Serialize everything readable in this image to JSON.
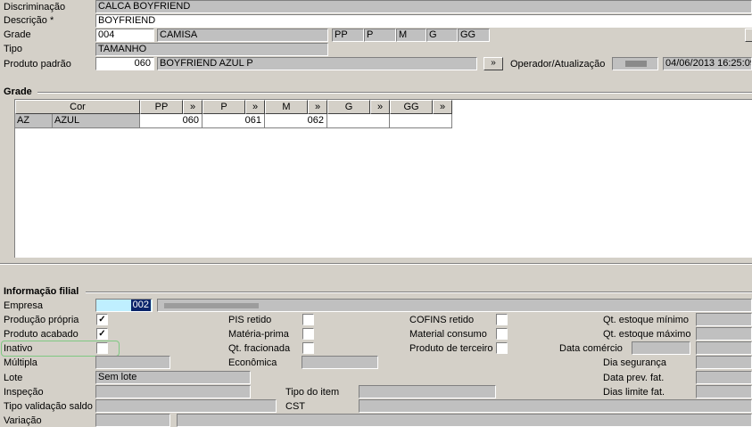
{
  "product": {
    "discriminacao_label": "Discriminação",
    "discriminacao_value": "CALCA BOYFRIEND",
    "descricao_label": "Descrição *",
    "descricao_value": "BOYFRIEND",
    "grade_label": "Grade",
    "grade_code": "004",
    "grade_name": "CAMISA",
    "grade_sizes": [
      "PP",
      "P",
      "M",
      "G",
      "GG"
    ],
    "tipo_label": "Tipo",
    "tipo_value": "TAMANHO",
    "produto_padrao_label": "Produto padrão",
    "produto_padrao_code": "060",
    "produto_padrao_name": "BOYFRIEND AZUL P",
    "lookup_icon": "»",
    "operador_label": "Operador/Atualização",
    "operador_datetime": "04/06/2013 16:25:09"
  },
  "grade": {
    "title": "Grade",
    "col_cor": "Cor",
    "sizes": [
      "PP",
      "P",
      "M",
      "G",
      "GG"
    ],
    "rows": [
      {
        "code": "AZ",
        "name": "AZUL",
        "values": [
          "060",
          "061",
          "062",
          "",
          ""
        ]
      }
    ]
  },
  "filial": {
    "title": "Informação filial",
    "empresa_label": "Empresa",
    "empresa_code": "002",
    "producao_propria_label": "Produção própria",
    "producao_propria_checked": true,
    "produto_acabado_label": "Produto acabado",
    "produto_acabado_checked": true,
    "inativo_label": "Inativo",
    "inativo_checked": false,
    "multipla_label": "Múltipla",
    "lote_label": "Lote",
    "lote_value": "Sem lote",
    "inspecao_label": "Inspeção",
    "tipo_validacao_label": "Tipo validação saldo",
    "variacao_label": "Variação",
    "pis_label": "PIS retido",
    "materia_prima_label": "Matéria-prima",
    "qt_fracionada_label": "Qt. fracionada",
    "economica_label": "Econômica",
    "tipo_item_label": "Tipo do item",
    "cst_label": "CST",
    "cofins_label": "COFINS retido",
    "material_consumo_label": "Material consumo",
    "produto_terceiro_label": "Produto de terceiro",
    "data_comercio_label": "Data comércio",
    "qt_estoque_min_label": "Qt. estoque mínimo",
    "qt_estoque_max_label": "Qt. estoque máximo",
    "dia_seguranca_label": "Dia segurança",
    "data_prev_fat_label": "Data prev. fat.",
    "dias_limite_fat_label": "Dias limite fat."
  }
}
